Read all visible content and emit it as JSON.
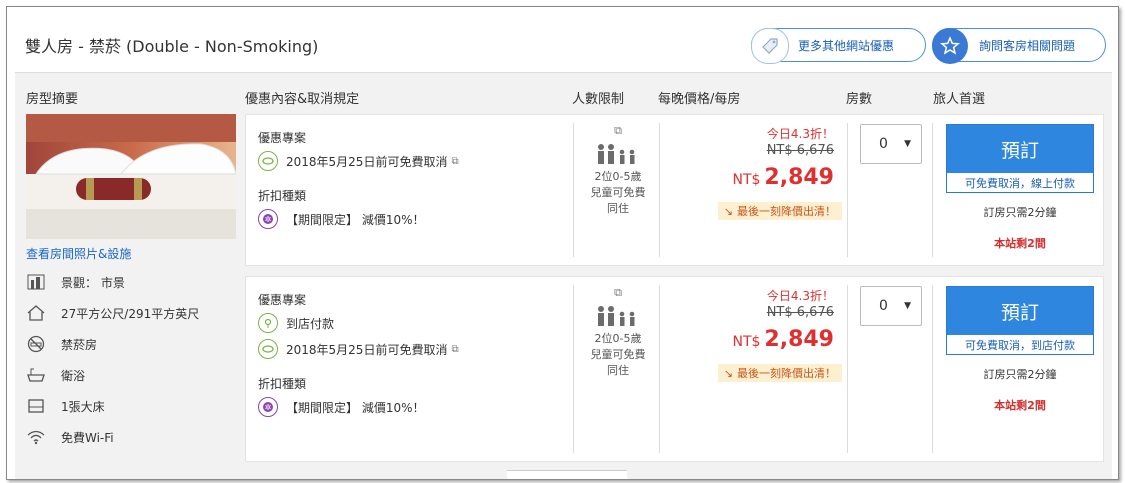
{
  "header": {
    "room_title": "雙人房 - 禁菸 (Double - Non-Smoking)",
    "more_deals_label": "更多其他網站優惠",
    "ask_label": "詢問客房相關問題"
  },
  "columns": {
    "summary": "房型摘要",
    "deal": "優惠內容&取消規定",
    "occupancy": "人數限制",
    "price": "每晚價格/每房",
    "rooms": "房數",
    "choice": "旅人首選"
  },
  "room": {
    "photo_link": "查看房間照片&設施",
    "features": [
      {
        "icon": "city-view-icon",
        "label": "景觀： 市景"
      },
      {
        "icon": "house-size-icon",
        "label": "27平方公尺/291平方英尺"
      },
      {
        "icon": "no-smoking-icon",
        "label": "禁菸房"
      },
      {
        "icon": "bath-icon",
        "label": "衛浴"
      },
      {
        "icon": "bed-icon",
        "label": "1張大床"
      },
      {
        "icon": "wifi-icon",
        "label": "免費Wi-Fi"
      }
    ]
  },
  "rates": [
    {
      "deal_title": "優惠專案",
      "policies": [
        "2018年5月25日前可免費取消"
      ],
      "discount_type_title": "折扣種類",
      "discount": "【期間限定】 減價10%！",
      "occupancy": [
        "2位0-5歲",
        "兒童可免費",
        "同住"
      ],
      "discount_label": "今日4.3折！",
      "original_price": "NT$ 6,676",
      "currency": "NT$",
      "price": "2,849",
      "last_minute": "最後一刻降價出清！",
      "rooms_value": "0",
      "book_label": "預訂",
      "book_sub": "可免費取消，線上付款",
      "note": "訂房只需2分鐘",
      "left": "本站剩2間"
    },
    {
      "deal_title": "優惠專案",
      "policies": [
        "到店付款",
        "2018年5月25日前可免費取消"
      ],
      "discount_type_title": "折扣種類",
      "discount": "【期間限定】 減價10%！",
      "occupancy": [
        "2位0-5歲",
        "兒童可免費",
        "同住"
      ],
      "discount_label": "今日4.3折！",
      "original_price": "NT$ 6,676",
      "currency": "NT$",
      "price": "2,849",
      "last_minute": "最後一刻降價出清！",
      "rooms_value": "0",
      "book_label": "預訂",
      "book_sub": "可免費取消，到店付款",
      "note": "訂房只需2分鐘",
      "left": "本站剩2間"
    }
  ]
}
